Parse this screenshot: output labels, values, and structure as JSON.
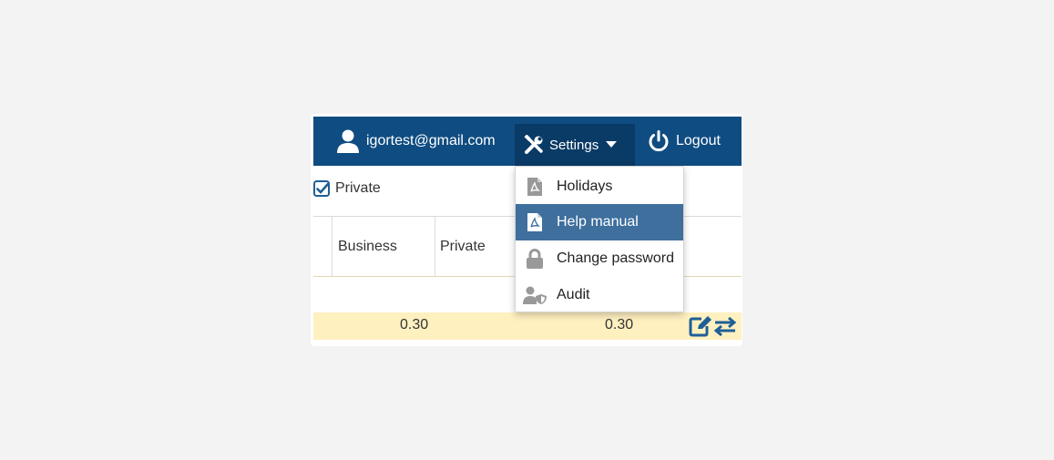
{
  "navbar": {
    "user_email": "igortest@gmail.com",
    "settings_label": "Settings",
    "logout_label": "Logout"
  },
  "filter": {
    "private_label": "Private",
    "private_checked": true
  },
  "table": {
    "headers": [
      "Business",
      "Private"
    ],
    "rows": [
      {
        "values": [
          "0.30",
          "0.30"
        ]
      }
    ]
  },
  "settings_menu": {
    "items": [
      {
        "label": "Holidays",
        "icon": "pdf-file-icon",
        "active": false
      },
      {
        "label": "Help manual",
        "icon": "pdf-file-icon",
        "active": true
      },
      {
        "label": "Change password",
        "icon": "lock-icon",
        "active": false
      },
      {
        "label": "Audit",
        "icon": "user-shield-icon",
        "active": false
      }
    ]
  },
  "colors": {
    "navbar": "#0f4c81",
    "navbar_active": "#0a3a66",
    "menu_active": "#3e6f9d",
    "row_highlight": "#fff0c0",
    "icon_gray": "#999999"
  }
}
